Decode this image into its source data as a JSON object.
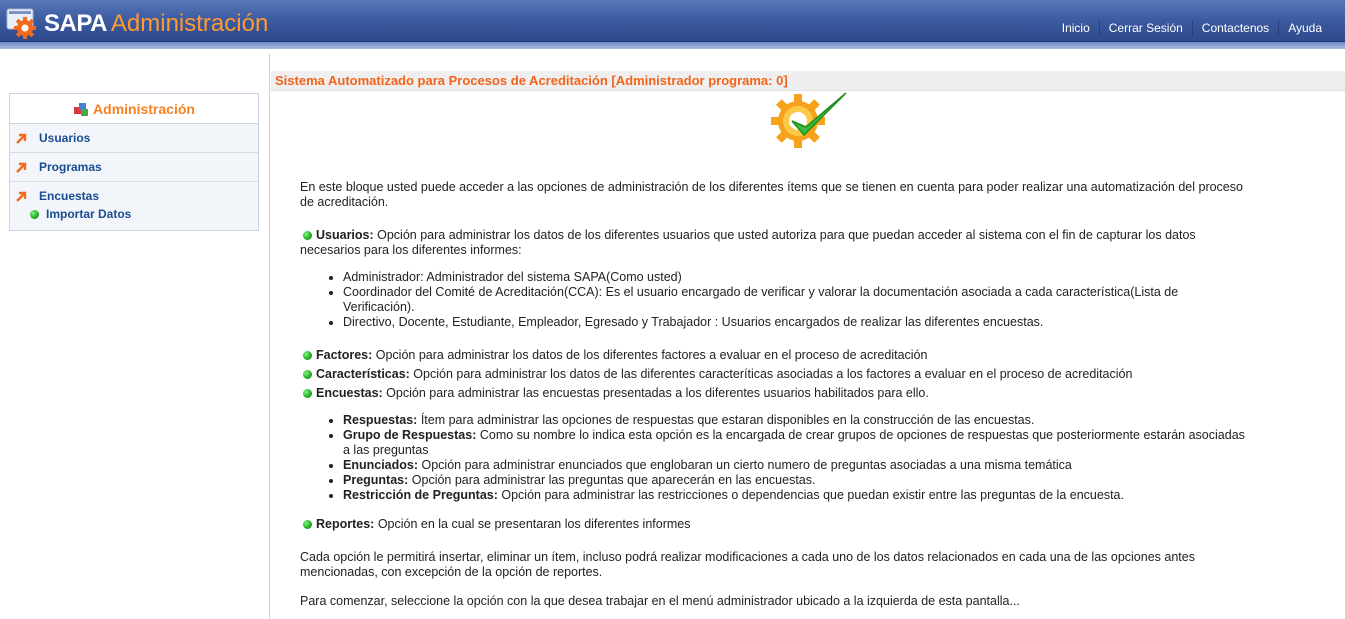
{
  "header": {
    "brand_sapa": "SAPA",
    "brand_admin": "Administración",
    "nav": [
      "Inicio",
      "Cerrar Sesión",
      "Contactenos",
      "Ayuda"
    ]
  },
  "sidebar": {
    "title": "Administración",
    "items": [
      {
        "label": "Usuarios",
        "icon": "orange-arrow-icon"
      },
      {
        "label": "Programas",
        "icon": "orange-arrow-icon"
      },
      {
        "label": "Encuestas",
        "icon": "orange-arrow-icon"
      }
    ],
    "subitem": {
      "label": "Importar Datos",
      "icon": "green-dot-icon"
    }
  },
  "main": {
    "title": "Sistema Automatizado para Procesos de Acreditación [Administrador programa: 0]",
    "intro": "En este bloque usted puede acceder a las opciones de administración de los diferentes ítems que se tienen en cuenta para poder realizar una automatización del proceso de acreditación.",
    "usuarios": {
      "term": "Usuarios:",
      "desc": " Opción para administrar los datos de los diferentes usuarios que usted autoriza para que puedan acceder al sistema con el fin de capturar los datos necesarios para los diferentes informes:",
      "list": [
        "Administrador: Administrador del sistema SAPA(Como usted)",
        "Coordinador del Comité de Acreditación(CCA): Es el usuario encargado de verificar y valorar la documentación asociada a cada característica(Lista de Verificación).",
        "Directivo, Docente, Estudiante, Empleador, Egresado y Trabajador : Usuarios encargados de realizar las diferentes encuestas."
      ]
    },
    "factores": {
      "term": "Factores:",
      "desc": " Opción para administrar los datos de los diferentes factores a evaluar en el proceso de acreditación"
    },
    "caracteristicas": {
      "term": "Características:",
      "desc": " Opción para administrar los datos de las diferentes caracteríticas asociadas a los factores a evaluar en el proceso de acreditación"
    },
    "encuestas": {
      "term": "Encuestas:",
      "desc": " Opción para administrar las encuestas presentadas a los diferentes usuarios habilitados para ello.",
      "list": [
        {
          "term": "Respuestas:",
          "desc": " Ítem para administrar las opciones de respuestas que estaran disponibles en la construcción de las encuestas."
        },
        {
          "term": "Grupo de Respuestas:",
          "desc": " Como su nombre lo indica esta opción es la encargada de crear grupos de opciones de respuestas que posteriormente estarán asociadas a las preguntas"
        },
        {
          "term": "Enunciados:",
          "desc": " Opción para administrar enunciados que englobaran un cierto numero de preguntas asociadas a una misma temática"
        },
        {
          "term": "Preguntas:",
          "desc": " Opción para administrar las preguntas que aparecerán en las encuestas."
        },
        {
          "term": "Restricción de Preguntas:",
          "desc": " Opción para administrar las restricciones o dependencias que puedan existir entre las preguntas de la encuesta."
        }
      ]
    },
    "reportes": {
      "term": "Reportes:",
      "desc": " Opción en la cual se presentaran los diferentes informes"
    },
    "outro1": "Cada opción le permitirá insertar, eliminar un ítem, incluso podrá realizar modificaciones a cada uno de los datos relacionados en cada una de las opciones antes mencionadas, con excepción de la opción de reportes.",
    "outro2": "Para comenzar, seleccione la opción con la que desea trabajar en el menú administrador ubicado a la izquierda de esta pantalla..."
  }
}
